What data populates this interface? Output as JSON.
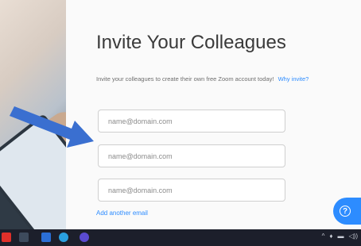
{
  "page": {
    "title": "Invite Your Colleagues",
    "subtitle": "Invite your colleagues to create their own free Zoom account today!",
    "why_invite_link": "Why invite?"
  },
  "emails": [
    {
      "placeholder": "name@domain.com",
      "value": ""
    },
    {
      "placeholder": "name@domain.com",
      "value": ""
    },
    {
      "placeholder": "name@domain.com",
      "value": ""
    }
  ],
  "add_email_link": "Add another email",
  "help_button": {
    "icon": "question-icon",
    "glyph": "?"
  },
  "annotation": {
    "type": "arrow",
    "color": "#3a6fd0",
    "target": "second email field"
  },
  "taskbar": {
    "icons": [
      "start-icon",
      "task-view-icon",
      "file-explorer-icon",
      "edge-icon",
      "teams-icon"
    ],
    "tray": [
      "^",
      "♦",
      "▬",
      "◁))"
    ]
  },
  "colors": {
    "accent": "#2d8cff",
    "title": "#3a3a3a",
    "taskbar": "#1c1f2b"
  }
}
